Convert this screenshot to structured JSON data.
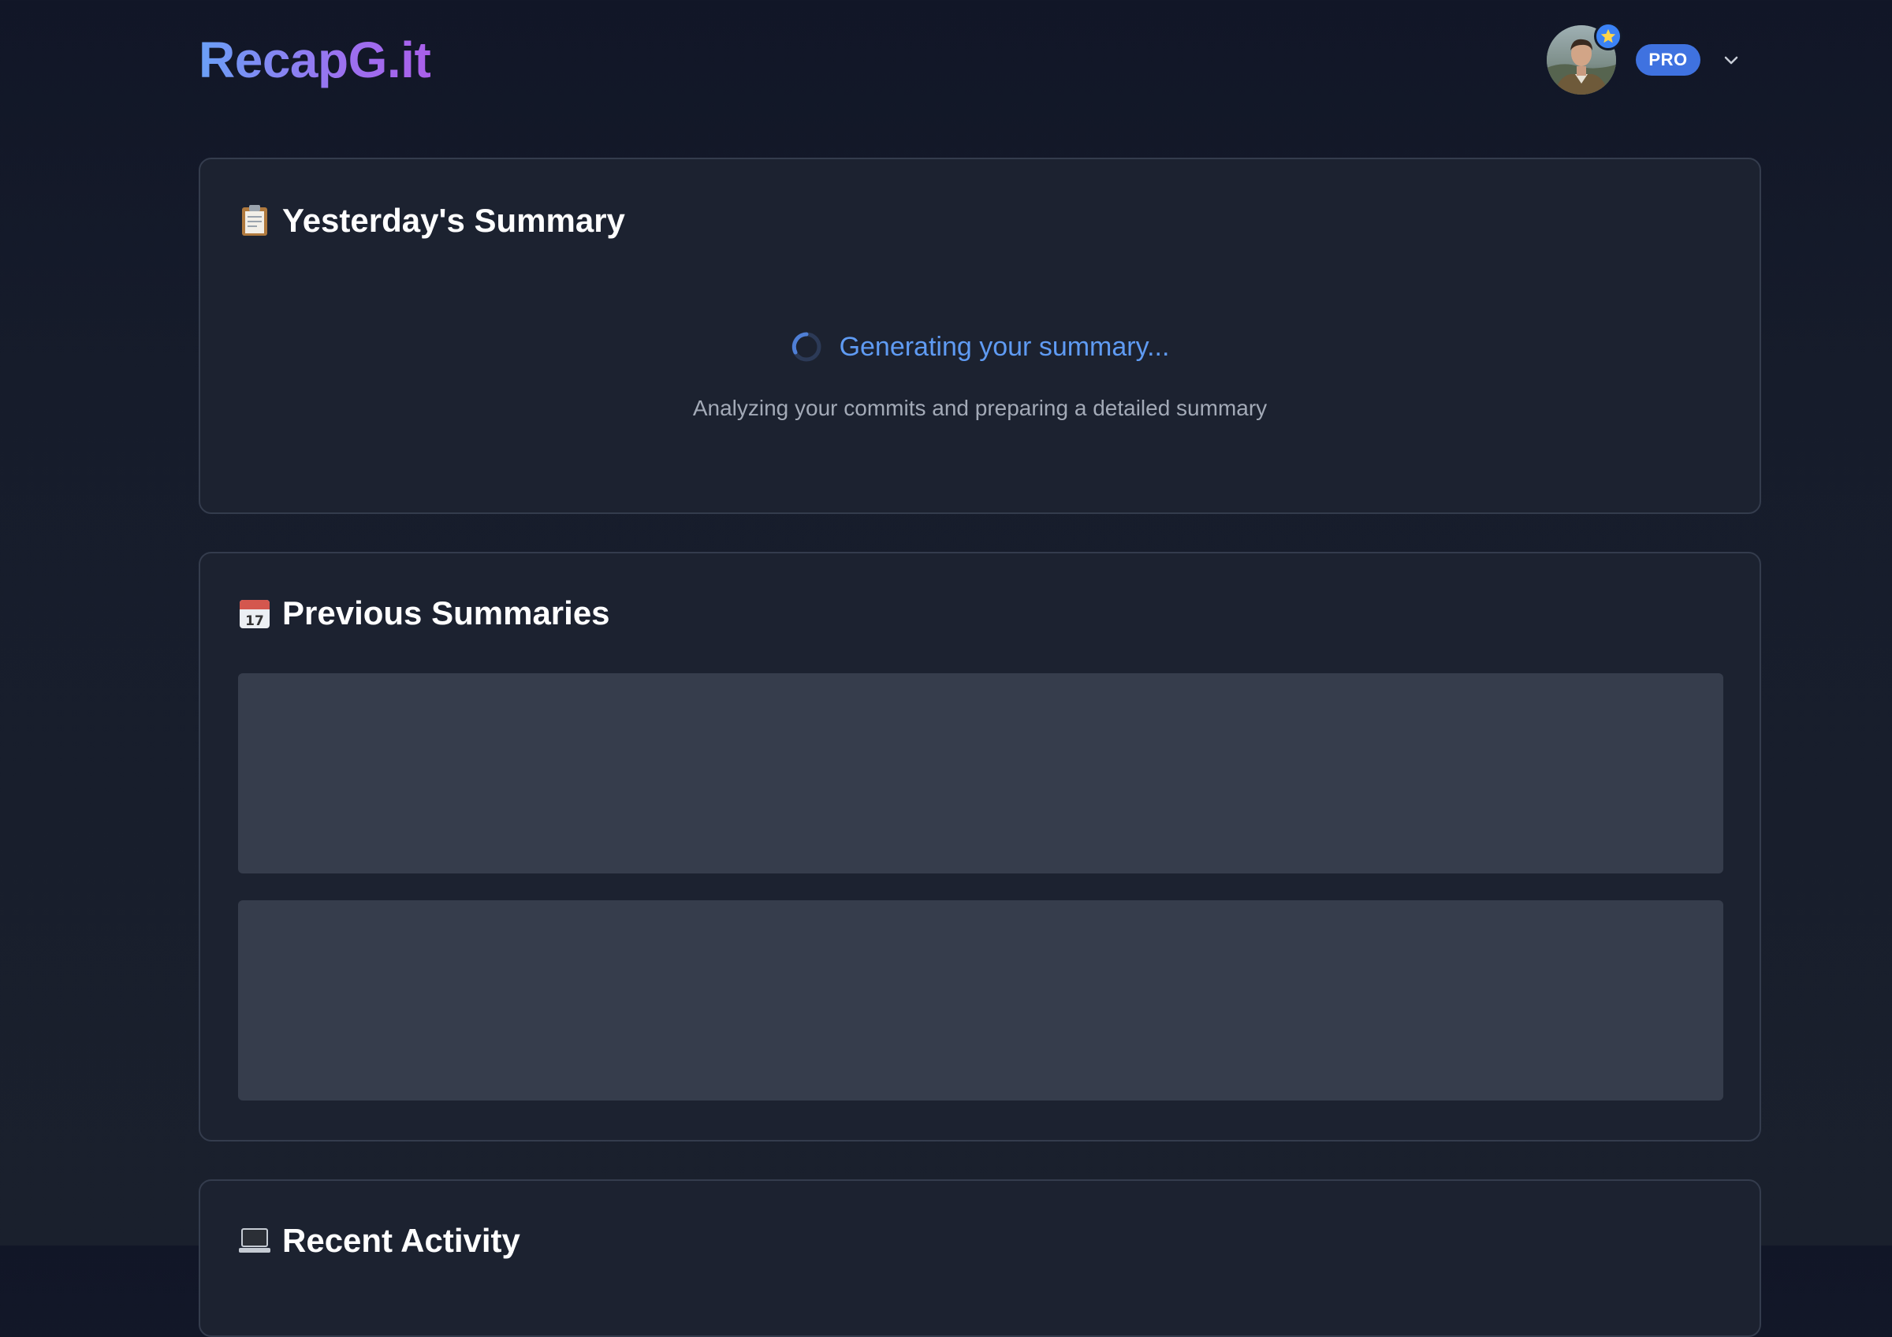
{
  "header": {
    "logo": "RecapG.it",
    "pro_badge": "PRO"
  },
  "summary_card": {
    "title": "Yesterday's Summary",
    "loading_text": "Generating your summary...",
    "loading_subtext": "Analyzing your commits and preparing a detailed summary"
  },
  "previous_card": {
    "title": "Previous Summaries"
  },
  "activity_card": {
    "title": "Recent Activity"
  },
  "icons": {
    "summary": "clipboard-icon",
    "previous": "calendar-icon",
    "activity": "laptop-icon",
    "avatar_badge": "star-icon",
    "menu": "chevron-down-icon"
  },
  "colors": {
    "accent": "#3f72e0",
    "loading_text": "#5f9bf3",
    "card_bg": "#1c2230",
    "skeleton": "#363d4c"
  }
}
